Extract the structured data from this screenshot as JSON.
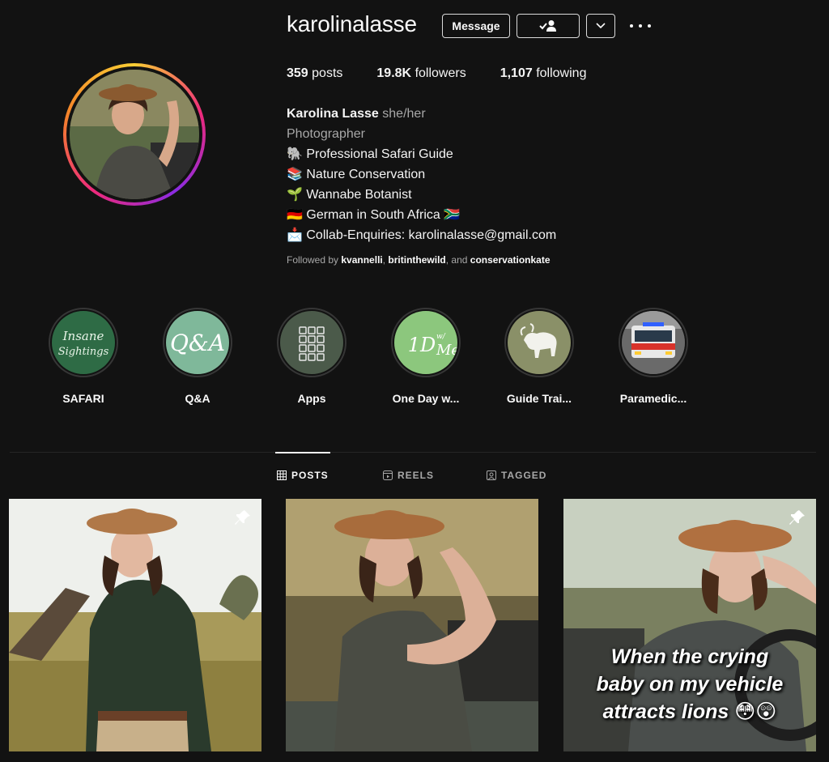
{
  "profile": {
    "username": "karolinalasse",
    "message_label": "Message",
    "stats": {
      "posts_count": "359",
      "posts_label": "posts",
      "followers_count": "19.8K",
      "followers_label": "followers",
      "following_count": "1,107",
      "following_label": "following"
    },
    "bio": {
      "name": "Karolina Lasse",
      "pronouns": "she/her",
      "category": "Photographer",
      "lines": [
        "🐘 Professional Safari Guide",
        "📚 Nature Conservation",
        "🌱 Wannabe Botanist",
        "🇩🇪 German in South Africa 🇿🇦",
        "📩 Collab-Enquiries: karolinalasse@gmail.com"
      ]
    },
    "followed_by": {
      "prefix": "Followed by",
      "users": [
        "kvannelli",
        "britinthewild",
        "conservationkate"
      ],
      "sep": ",",
      "and": ", and"
    }
  },
  "highlights": [
    {
      "label": "SAFARI",
      "cover_text": "Insane Sightings",
      "color": "#2e6b45"
    },
    {
      "label": "Q&A",
      "cover_text": "Q&A",
      "color": "#7fb89a"
    },
    {
      "label": "Apps",
      "cover_text": "",
      "color": "#4b5a4a"
    },
    {
      "label": "One Day w...",
      "cover_text": "1D w/ Me",
      "color": "#8cc77d"
    },
    {
      "label": "Guide Trai...",
      "cover_text": "",
      "color": "#8a9068"
    },
    {
      "label": "Paramedic...",
      "cover_text": "",
      "color": "#3a3a3a"
    }
  ],
  "tabs": [
    {
      "label": "POSTS",
      "icon": "grid-icon",
      "active": true
    },
    {
      "label": "REELS",
      "icon": "reels-icon",
      "active": false
    },
    {
      "label": "TAGGED",
      "icon": "tagged-icon",
      "active": false
    }
  ],
  "posts": [
    {
      "pinned": true,
      "caption": ""
    },
    {
      "pinned": false,
      "caption": ""
    },
    {
      "pinned": true,
      "caption_lines": [
        "When the crying",
        "baby on my vehicle",
        "attracts lions 😳😲"
      ]
    }
  ],
  "colors": {
    "background": "#121212",
    "text": "#f5f5f5",
    "secondary_text": "#a8a8a8",
    "divider": "#262626"
  }
}
